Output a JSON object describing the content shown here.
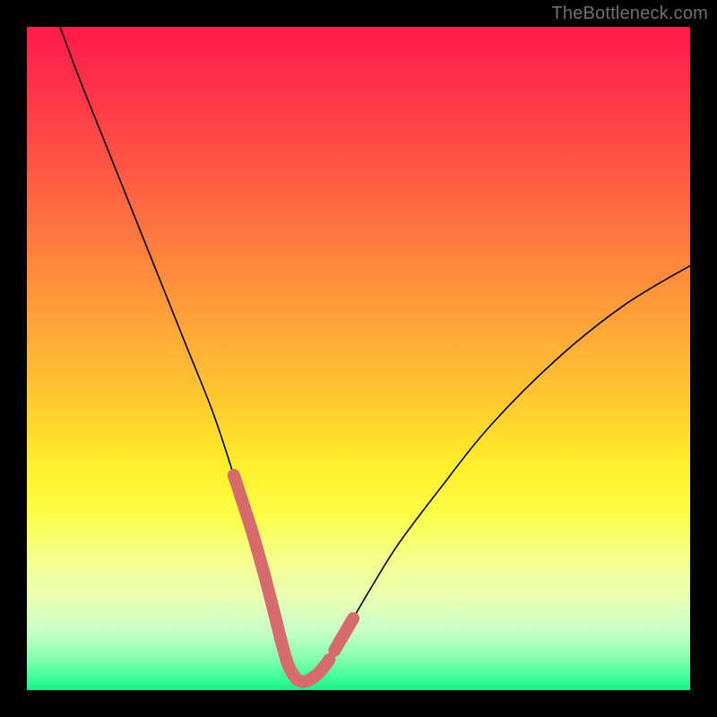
{
  "watermark": "TheBottleneck.com",
  "chart_data": {
    "type": "line",
    "title": "",
    "xlabel": "",
    "ylabel": "",
    "xlim": [
      0,
      100
    ],
    "ylim": [
      0,
      100
    ],
    "grid": false,
    "legend": false,
    "series": [
      {
        "name": "bottleneck-curve",
        "color": "#000000",
        "stroke_width": 1.6,
        "x": [
          5,
          8,
          12,
          16,
          20,
          24,
          28,
          31,
          33.5,
          35.5,
          37,
          38.3,
          39.3,
          40.2,
          41,
          42.2,
          44,
          45.5,
          47,
          49,
          52,
          56,
          62,
          70,
          80,
          90,
          100
        ],
        "y": [
          100,
          92,
          82,
          72,
          62,
          52,
          42,
          33,
          25,
          18,
          12,
          7,
          4,
          2.2,
          1.4,
          1.4,
          2.6,
          4.5,
          7.2,
          10.5,
          15.6,
          22,
          30,
          40,
          50,
          58,
          64
        ]
      },
      {
        "name": "marker-overlay",
        "color": "#d76a6a",
        "stroke_width": 14,
        "linecap": "round",
        "segments": [
          {
            "x": [
              31.2,
              33.8,
              35.8,
              37.3,
              38.5,
              39.4,
              40.3,
              41.1,
              42.3,
              44.1,
              45.6
            ],
            "y": [
              32.4,
              24.4,
              17.4,
              11.6,
              6.8,
              3.8,
              2.1,
              1.4,
              1.4,
              2.7,
              4.6
            ]
          },
          {
            "x": [
              46.4,
              47.2,
              49.2
            ],
            "y": [
              6.0,
              7.4,
              10.8
            ]
          }
        ]
      }
    ],
    "gradient_stops": [
      {
        "pct": 0,
        "color": "#ff1a4a"
      },
      {
        "pct": 8,
        "color": "#ff2f4a"
      },
      {
        "pct": 20,
        "color": "#ff5344"
      },
      {
        "pct": 32,
        "color": "#ff7a3e"
      },
      {
        "pct": 44,
        "color": "#ffa238"
      },
      {
        "pct": 56,
        "color": "#ffc830"
      },
      {
        "pct": 66,
        "color": "#ffee2a"
      },
      {
        "pct": 74,
        "color": "#fcff4a"
      },
      {
        "pct": 80,
        "color": "#f4ff8a"
      },
      {
        "pct": 86,
        "color": "#eaffb2"
      },
      {
        "pct": 91,
        "color": "#c8ffc8"
      },
      {
        "pct": 95,
        "color": "#8affb0"
      },
      {
        "pct": 98,
        "color": "#3eff9a"
      },
      {
        "pct": 100,
        "color": "#18ef86"
      }
    ]
  }
}
